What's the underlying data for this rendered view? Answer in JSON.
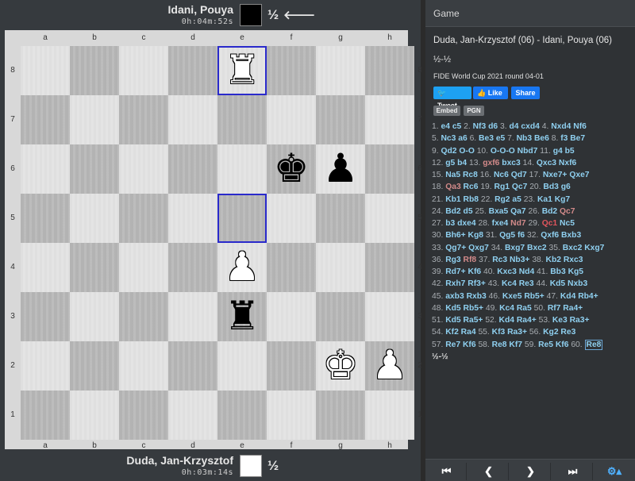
{
  "top_player": {
    "name": "Idani, Pouya",
    "clock": "0h:04m:52s",
    "result": "½",
    "turn_indicator": "🡐"
  },
  "bottom_player": {
    "name": "Duda, Jan-Krzysztof",
    "clock": "0h:03m:14s",
    "result": "½"
  },
  "board": {
    "files": [
      "a",
      "b",
      "c",
      "d",
      "e",
      "f",
      "g",
      "h"
    ],
    "ranks": [
      "8",
      "7",
      "6",
      "5",
      "4",
      "3",
      "2",
      "1"
    ],
    "highlighted_squares": [
      "e8",
      "e5"
    ],
    "pieces": [
      {
        "square": "e8",
        "piece": "rook",
        "color": "white",
        "glyph": "♜"
      },
      {
        "square": "f6",
        "piece": "king",
        "color": "black",
        "glyph": "♚"
      },
      {
        "square": "g6",
        "piece": "pawn",
        "color": "black",
        "glyph": "♟"
      },
      {
        "square": "e4",
        "piece": "pawn",
        "color": "white",
        "glyph": "♟"
      },
      {
        "square": "e3",
        "piece": "rook",
        "color": "black",
        "glyph": "♜"
      },
      {
        "square": "g2",
        "piece": "king",
        "color": "white",
        "glyph": "♚"
      },
      {
        "square": "h2",
        "piece": "pawn",
        "color": "white",
        "glyph": "♟"
      }
    ]
  },
  "panel": {
    "header": "Game",
    "match_title": "Duda, Jan-Krzysztof (06) - Idani, Pouya (06)",
    "result": "½-½",
    "event": "FIDE World Cup 2021 round 04-01",
    "tweet": "Tweet",
    "like": "Like",
    "share": "Share",
    "embed": "Embed",
    "pgn": "PGN",
    "final_result": "½-½",
    "nav": {
      "first": "⏮",
      "prev": "❮",
      "next": "❯",
      "last": "⏭",
      "settings": "⚙▴"
    }
  },
  "colors": {
    "accent": "#4fb1ff",
    "move": "#8fd0f0",
    "dubious": "#d28a8a",
    "blunder": "#e0555d"
  },
  "move_lines": [
    [
      [
        "n",
        "1."
      ],
      [
        "m",
        "e4"
      ],
      [
        "m",
        "c5"
      ],
      [
        "n",
        "2."
      ],
      [
        "m",
        "Nf3"
      ],
      [
        "m",
        "d6"
      ],
      [
        "n",
        "3."
      ],
      [
        "m",
        "d4"
      ],
      [
        "m",
        "cxd4"
      ],
      [
        "n",
        "4."
      ],
      [
        "m",
        "Nxd4"
      ],
      [
        "m",
        "Nf6"
      ]
    ],
    [
      [
        "n",
        "5."
      ],
      [
        "m",
        "Nc3"
      ],
      [
        "m",
        "a6"
      ],
      [
        "n",
        "6."
      ],
      [
        "m",
        "Be3"
      ],
      [
        "m",
        "e5"
      ],
      [
        "n",
        "7."
      ],
      [
        "m",
        "Nb3"
      ],
      [
        "m",
        "Be6"
      ],
      [
        "n",
        "8."
      ],
      [
        "m",
        "f3"
      ],
      [
        "m",
        "Be7"
      ]
    ],
    [
      [
        "n",
        "9."
      ],
      [
        "m",
        "Qd2"
      ],
      [
        "m",
        "O-O"
      ],
      [
        "n",
        "10."
      ],
      [
        "m",
        "O-O-O"
      ],
      [
        "m",
        "Nbd7"
      ],
      [
        "n",
        "11."
      ],
      [
        "m",
        "g4"
      ],
      [
        "m",
        "b5"
      ]
    ],
    [
      [
        "n",
        "12."
      ],
      [
        "m",
        "g5"
      ],
      [
        "m",
        "b4"
      ],
      [
        "n",
        "13."
      ],
      [
        "d",
        "gxf6"
      ],
      [
        "m",
        "bxc3"
      ],
      [
        "n",
        "14."
      ],
      [
        "m",
        "Qxc3"
      ],
      [
        "m",
        "Nxf6"
      ]
    ],
    [
      [
        "n",
        "15."
      ],
      [
        "m",
        "Na5"
      ],
      [
        "m",
        "Rc8"
      ],
      [
        "n",
        "16."
      ],
      [
        "m",
        "Nc6"
      ],
      [
        "m",
        "Qd7"
      ],
      [
        "n",
        "17."
      ],
      [
        "m",
        "Nxe7+"
      ],
      [
        "m",
        "Qxe7"
      ]
    ],
    [
      [
        "n",
        "18."
      ],
      [
        "d",
        "Qa3"
      ],
      [
        "m",
        "Rc6"
      ],
      [
        "n",
        "19."
      ],
      [
        "m",
        "Rg1"
      ],
      [
        "m",
        "Qc7"
      ],
      [
        "n",
        "20."
      ],
      [
        "m",
        "Bd3"
      ],
      [
        "m",
        "g6"
      ]
    ],
    [
      [
        "n",
        "21."
      ],
      [
        "m",
        "Kb1"
      ],
      [
        "m",
        "Rb8"
      ],
      [
        "n",
        "22."
      ],
      [
        "m",
        "Rg2"
      ],
      [
        "m",
        "a5"
      ],
      [
        "n",
        "23."
      ],
      [
        "m",
        "Ka1"
      ],
      [
        "m",
        "Kg7"
      ]
    ],
    [
      [
        "n",
        "24."
      ],
      [
        "m",
        "Bd2"
      ],
      [
        "m",
        "d5"
      ],
      [
        "n",
        "25."
      ],
      [
        "m",
        "Bxa5"
      ],
      [
        "m",
        "Qa7"
      ],
      [
        "n",
        "26."
      ],
      [
        "m",
        "Bd2"
      ],
      [
        "d",
        "Qc7"
      ]
    ],
    [
      [
        "n",
        "27."
      ],
      [
        "m",
        "b3"
      ],
      [
        "m",
        "dxe4"
      ],
      [
        "n",
        "28."
      ],
      [
        "m",
        "fxe4"
      ],
      [
        "d",
        "Nd7"
      ],
      [
        "n",
        "29."
      ],
      [
        "b",
        "Qc1"
      ],
      [
        "m",
        "Nc5"
      ]
    ],
    [
      [
        "n",
        "30."
      ],
      [
        "m",
        "Bh6+"
      ],
      [
        "m",
        "Kg8"
      ],
      [
        "n",
        "31."
      ],
      [
        "m",
        "Qg5"
      ],
      [
        "m",
        "f6"
      ],
      [
        "n",
        "32."
      ],
      [
        "m",
        "Qxf6"
      ],
      [
        "m",
        "Bxb3"
      ]
    ],
    [
      [
        "n",
        "33."
      ],
      [
        "m",
        "Qg7+"
      ],
      [
        "m",
        "Qxg7"
      ],
      [
        "n",
        "34."
      ],
      [
        "m",
        "Bxg7"
      ],
      [
        "m",
        "Bxc2"
      ],
      [
        "n",
        "35."
      ],
      [
        "m",
        "Bxc2"
      ],
      [
        "m",
        "Kxg7"
      ]
    ],
    [
      [
        "n",
        "36."
      ],
      [
        "m",
        "Rg3"
      ],
      [
        "d",
        "Rf8"
      ],
      [
        "n",
        "37."
      ],
      [
        "m",
        "Rc3"
      ],
      [
        "m",
        "Nb3+"
      ],
      [
        "n",
        "38."
      ],
      [
        "m",
        "Kb2"
      ],
      [
        "m",
        "Rxc3"
      ]
    ],
    [
      [
        "n",
        "39."
      ],
      [
        "m",
        "Rd7+"
      ],
      [
        "m",
        "Kf6"
      ],
      [
        "n",
        "40."
      ],
      [
        "m",
        "Kxc3"
      ],
      [
        "m",
        "Nd4"
      ],
      [
        "n",
        "41."
      ],
      [
        "m",
        "Bb3"
      ],
      [
        "m",
        "Kg5"
      ]
    ],
    [
      [
        "n",
        "42."
      ],
      [
        "m",
        "Rxh7"
      ],
      [
        "m",
        "Rf3+"
      ],
      [
        "n",
        "43."
      ],
      [
        "m",
        "Kc4"
      ],
      [
        "m",
        "Re3"
      ],
      [
        "n",
        "44."
      ],
      [
        "m",
        "Kd5"
      ],
      [
        "m",
        "Nxb3"
      ]
    ],
    [
      [
        "n",
        "45."
      ],
      [
        "m",
        "axb3"
      ],
      [
        "m",
        "Rxb3"
      ],
      [
        "n",
        "46."
      ],
      [
        "m",
        "Kxe5"
      ],
      [
        "m",
        "Rb5+"
      ],
      [
        "n",
        "47."
      ],
      [
        "m",
        "Kd4"
      ],
      [
        "m",
        "Rb4+"
      ]
    ],
    [
      [
        "n",
        "48."
      ],
      [
        "m",
        "Kd5"
      ],
      [
        "m",
        "Rb5+"
      ],
      [
        "n",
        "49."
      ],
      [
        "m",
        "Kc4"
      ],
      [
        "m",
        "Ra5"
      ],
      [
        "n",
        "50."
      ],
      [
        "m",
        "Rf7"
      ],
      [
        "m",
        "Ra4+"
      ]
    ],
    [
      [
        "n",
        "51."
      ],
      [
        "m",
        "Kd5"
      ],
      [
        "m",
        "Ra5+"
      ],
      [
        "n",
        "52."
      ],
      [
        "m",
        "Kd4"
      ],
      [
        "m",
        "Ra4+"
      ],
      [
        "n",
        "53."
      ],
      [
        "m",
        "Ke3"
      ],
      [
        "m",
        "Ra3+"
      ]
    ],
    [
      [
        "n",
        "54."
      ],
      [
        "m",
        "Kf2"
      ],
      [
        "m",
        "Ra4"
      ],
      [
        "n",
        "55."
      ],
      [
        "m",
        "Kf3"
      ],
      [
        "m",
        "Ra3+"
      ],
      [
        "n",
        "56."
      ],
      [
        "m",
        "Kg2"
      ],
      [
        "m",
        "Re3"
      ]
    ],
    [
      [
        "n",
        "57."
      ],
      [
        "m",
        "Re7"
      ],
      [
        "m",
        "Kf6"
      ],
      [
        "n",
        "58."
      ],
      [
        "m",
        "Re8"
      ],
      [
        "m",
        "Kf7"
      ],
      [
        "n",
        "59."
      ],
      [
        "m",
        "Re5"
      ],
      [
        "m",
        "Kf6"
      ],
      [
        "n",
        "60."
      ],
      [
        "c",
        "Re8"
      ]
    ]
  ]
}
